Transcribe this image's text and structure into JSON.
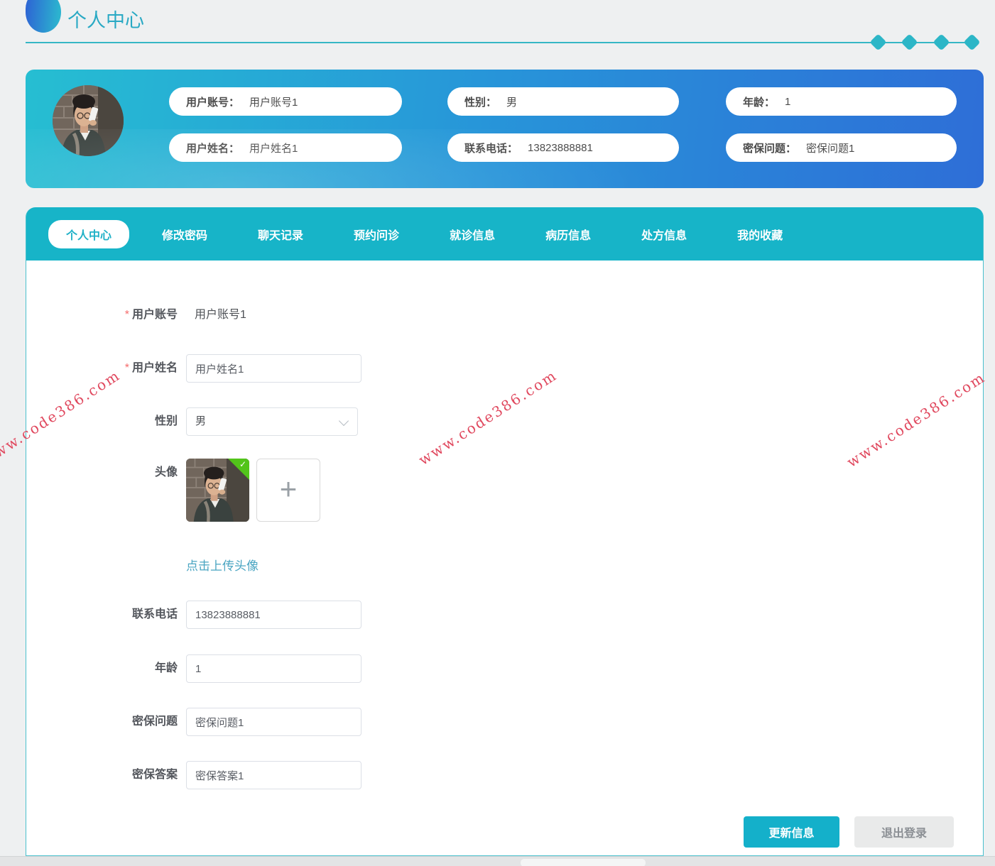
{
  "page": {
    "title": "个人中心"
  },
  "banner": {
    "fields": [
      {
        "label": "用户账号：",
        "value": "用户账号1"
      },
      {
        "label": "性别：",
        "value": "男"
      },
      {
        "label": "年龄：",
        "value": "1"
      },
      {
        "label": "用户姓名：",
        "value": "用户姓名1"
      },
      {
        "label": "联系电话：",
        "value": "13823888881"
      },
      {
        "label": "密保问题：",
        "value": "密保问题1"
      }
    ]
  },
  "tabs": {
    "active": "个人中心",
    "items": [
      {
        "label": "个人中心"
      },
      {
        "label": "修改密码"
      },
      {
        "label": "聊天记录"
      },
      {
        "label": "预约问诊"
      },
      {
        "label": "就诊信息"
      },
      {
        "label": "病历信息"
      },
      {
        "label": "处方信息"
      },
      {
        "label": "我的收藏"
      }
    ]
  },
  "form": {
    "account": {
      "required": "*",
      "label": "用户账号",
      "value": "用户账号1"
    },
    "name": {
      "required": "*",
      "label": "用户姓名",
      "value": "用户姓名1"
    },
    "gender": {
      "label": "性别",
      "value": "男"
    },
    "avatar": {
      "label": "头像",
      "hint": "点击上传头像",
      "plus": "+",
      "check": "✓"
    },
    "phone": {
      "label": "联系电话",
      "value": "13823888881"
    },
    "age": {
      "label": "年龄",
      "value": "1"
    },
    "question": {
      "label": "密保问题",
      "value": "密保问题1"
    },
    "answer": {
      "label": "密保答案",
      "value": "密保答案1"
    }
  },
  "actions": {
    "update": "更新信息",
    "logout": "退出登录"
  },
  "watermark": {
    "text": "www.code386.com"
  },
  "colors": {
    "accent": "#17b4c8",
    "banner_gradient_start": "#26bed2",
    "banner_gradient_end": "#2e6ed7",
    "watermark": "#e0485e",
    "required_mark": "#f56c6c",
    "upload_success": "#52c41a"
  }
}
